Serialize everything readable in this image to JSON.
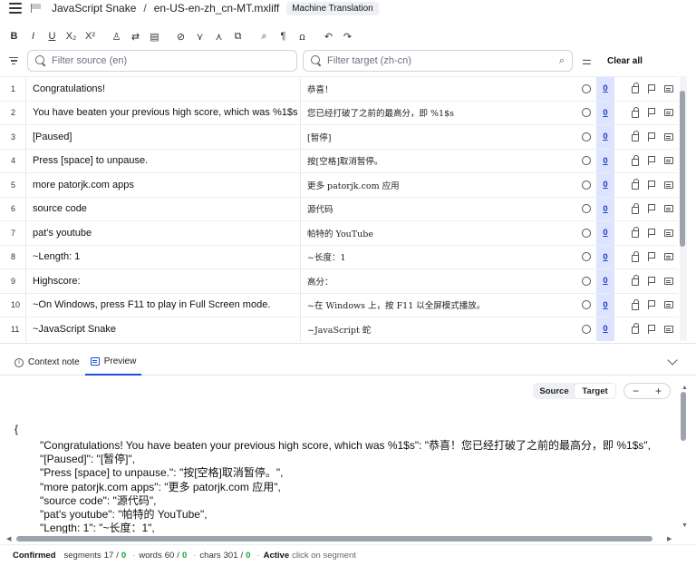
{
  "header": {
    "project": "JavaScript Snake",
    "separator": "/",
    "file": "en-US-en-zh_cn-MT.mxliff",
    "badge": "Machine Translation"
  },
  "toolbar": {
    "buttons": [
      {
        "name": "bold",
        "glyph": "B"
      },
      {
        "name": "italic",
        "glyph": "I"
      },
      {
        "name": "underline",
        "glyph": "U"
      },
      {
        "name": "subscript",
        "glyph": "X₂"
      },
      {
        "name": "superscript",
        "glyph": "X²"
      },
      {
        "name": "format-painter",
        "glyph": "♙"
      },
      {
        "name": "swap",
        "glyph": "⇄"
      },
      {
        "name": "notes",
        "glyph": "▤"
      },
      {
        "name": "confirm",
        "glyph": "⊘"
      },
      {
        "name": "merge",
        "glyph": "⋎"
      },
      {
        "name": "split",
        "glyph": "⋏"
      },
      {
        "name": "copy-source",
        "glyph": "⧉"
      },
      {
        "name": "find-replace",
        "glyph": "⌕"
      },
      {
        "name": "pilcrow",
        "glyph": "¶"
      },
      {
        "name": "spellcheck",
        "glyph": "ꭥ"
      },
      {
        "name": "undo",
        "glyph": "↶"
      },
      {
        "name": "redo",
        "glyph": "↷"
      }
    ]
  },
  "filters": {
    "source_placeholder": "Filter source (en)",
    "target_placeholder": "Filter target (zh-cn)",
    "clear_all": "Clear all"
  },
  "segments": [
    {
      "num": "1",
      "source": "Congratulations!",
      "target": "恭喜！",
      "count": "0"
    },
    {
      "num": "2",
      "source": "You have beaten your previous high score, which was %1$s",
      "target": "您已经打破了之前的最高分，即 %1$s",
      "count": "0"
    },
    {
      "num": "3",
      "source": "[Paused]",
      "target": "[暂停]",
      "count": "0"
    },
    {
      "num": "4",
      "source": "Press [space] to unpause.",
      "target": "按[空格]取消暂停。",
      "count": "0"
    },
    {
      "num": "5",
      "source": "more patorjk.com apps",
      "target": "更多 patorjk.com 应用",
      "count": "0"
    },
    {
      "num": "6",
      "source": "source code",
      "target": "源代码",
      "count": "0"
    },
    {
      "num": "7",
      "source": "pat's youtube",
      "target": "帕特的 YouTube",
      "count": "0"
    },
    {
      "num": "8",
      "source": "~Length: 1",
      "target": "~长度：1",
      "count": "0"
    },
    {
      "num": "9",
      "source": "Highscore:",
      "target": "高分：",
      "count": "0"
    },
    {
      "num": "10",
      "source": "~On Windows, press F11 to play in Full Screen mode.",
      "target": "~在 Windows 上，按 F11 以全屏模式播放。",
      "count": "0"
    },
    {
      "num": "11",
      "source": "~JavaScript Snake",
      "target": "~JavaScript 蛇",
      "count": "0"
    }
  ],
  "panel": {
    "tab_context": "Context note",
    "tab_preview": "Preview",
    "toggle_source": "Source",
    "toggle_target": "Target",
    "zoom_out": "−",
    "zoom_in": "+"
  },
  "preview_lines": [
    "{",
    "\"Congratulations! You have beaten your previous high score, which was %1$s\": \"恭喜！您已经打破了之前的最高分，即 %1$s\",",
    "\"[Paused]\": \"[暂停]\",",
    "\"Press [space] to unpause.\": \"按[空格]取消暂停。\",",
    "\"more patorjk.com apps\": \"更多 patorjk.com 应用\",",
    "\"source code\": \"源代码\",",
    "\"pat's youtube\": \"帕特的 YouTube\",",
    "\"Length: 1\": \"~长度：1\","
  ],
  "status": {
    "confirmed_label": "Confirmed",
    "segments_label": "segments",
    "segments_value": "17",
    "segments_confirmed": "0",
    "words_label": "words",
    "words_value": "60",
    "words_confirmed": "0",
    "chars_label": "chars",
    "chars_value": "301",
    "chars_confirmed": "0",
    "active_label": "Active",
    "active_hint": "click on segment",
    "slash": "/",
    "dot": "·"
  }
}
